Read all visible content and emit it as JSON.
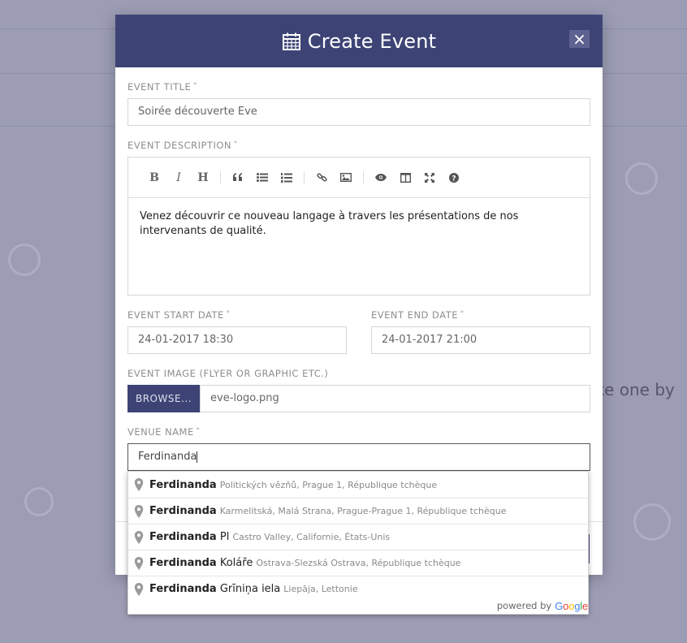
{
  "background": {
    "partial_text": "ate one by",
    "color": "#9c9db5"
  },
  "modal": {
    "title": "Create Event",
    "title_icon": "calendar-icon",
    "close_label": "×",
    "header_color": "#3d4475"
  },
  "form": {
    "title_label": "EVENT TITLE",
    "title_value": "Soirée découverte Eve",
    "description_label": "EVENT DESCRIPTION",
    "description_value": "Venez découvrir ce nouveau langage à travers les présentations de nos intervenants de qualité.",
    "toolbar": [
      {
        "name": "bold-button",
        "label": "B",
        "icon": "bold-icon"
      },
      {
        "name": "italic-button",
        "label": "I",
        "icon": "italic-icon"
      },
      {
        "name": "heading-button",
        "label": "H",
        "icon": "heading-icon"
      },
      {
        "name": "quote-button",
        "label": "❝",
        "icon": "quote-icon"
      },
      {
        "name": "unordered-list-button",
        "label": "",
        "icon": "list-ul-icon"
      },
      {
        "name": "ordered-list-button",
        "label": "",
        "icon": "list-ol-icon"
      },
      {
        "name": "link-button",
        "label": "",
        "icon": "link-icon"
      },
      {
        "name": "image-button",
        "label": "",
        "icon": "image-icon"
      },
      {
        "name": "preview-button",
        "label": "",
        "icon": "eye-icon"
      },
      {
        "name": "side-by-side-button",
        "label": "",
        "icon": "columns-icon"
      },
      {
        "name": "fullscreen-button",
        "label": "",
        "icon": "fullscreen-icon"
      },
      {
        "name": "help-button",
        "label": "?",
        "icon": "question-icon"
      }
    ],
    "start_date_label": "EVENT START DATE",
    "start_date_value": "24-01-2017 18:30",
    "end_date_label": "EVENT END DATE",
    "end_date_value": "24-01-2017 21:00",
    "image_label": "EVENT IMAGE (FLYER OR GRAPHIC ETC.)",
    "browse_label": "BROWSE...",
    "image_value": "eve-logo.png",
    "venue_label": "VENUE NAME",
    "venue_value": "Ferdinanda",
    "required_mark": "*"
  },
  "autocomplete": {
    "items": [
      {
        "match": "Ferdinanda",
        "rest": "",
        "secondary": "Politických vězňů, Prague 1, République tchèque"
      },
      {
        "match": "Ferdinanda",
        "rest": "",
        "secondary": "Karmelitská, Malá Strana, Prague-Prague 1, République tchèque"
      },
      {
        "match": "Ferdinanda",
        "rest": " Pl",
        "secondary": "Castro Valley, Californie, États-Unis"
      },
      {
        "match": "Ferdinanda",
        "rest": " Koláře",
        "secondary": "Ostrava-Slezská Ostrava, République tchèque"
      },
      {
        "match": "Ferdinanda",
        "rest": " Grīniņa iela",
        "secondary": "Liepāja, Lettonie"
      }
    ],
    "powered_by": "powered by",
    "google": "Google",
    "google_colors": [
      "#4285f4",
      "#ea4335",
      "#fbbc05",
      "#4285f4",
      "#34a853",
      "#ea4335"
    ]
  }
}
